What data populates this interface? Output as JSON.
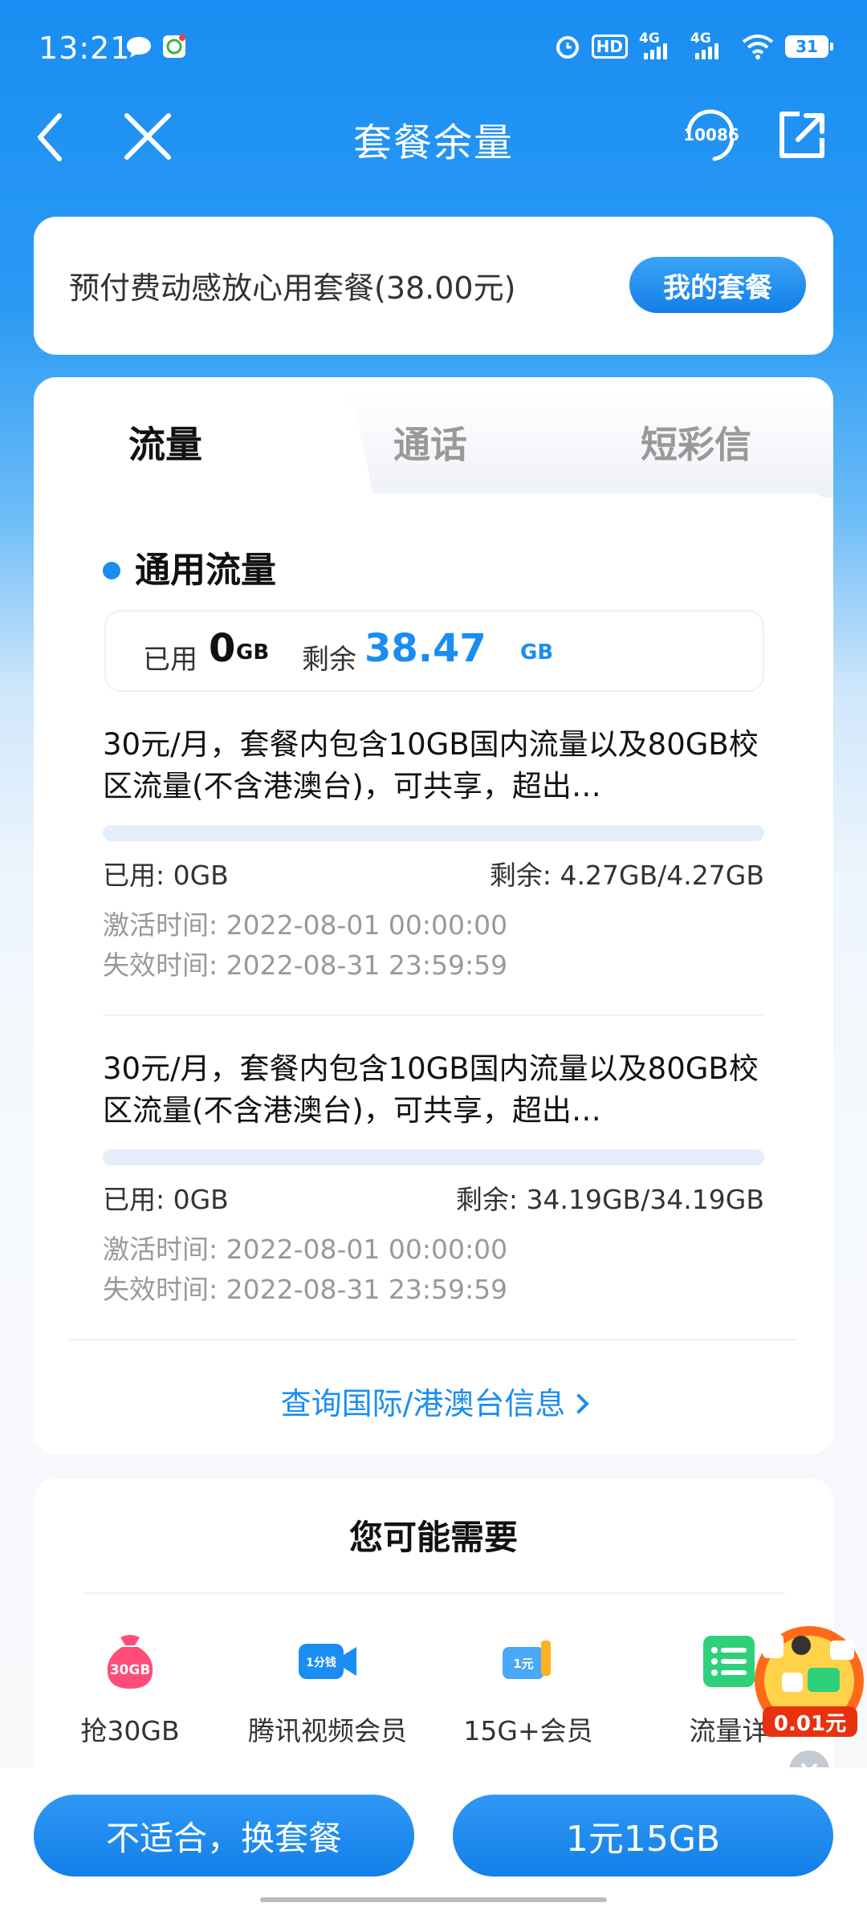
{
  "status_bar": {
    "time": "13:21",
    "hd_label": "HD",
    "network_1": "4G",
    "network_2": "4G",
    "battery": "31"
  },
  "nav": {
    "title": "套餐余量",
    "service_number": "10086"
  },
  "plan": {
    "name": "预付费动感放心用套餐(38.00元)",
    "my_plan_button": "我的套餐"
  },
  "tabs": [
    {
      "label": "流量",
      "active": true
    },
    {
      "label": "通话",
      "active": false
    },
    {
      "label": "短彩信",
      "active": false
    }
  ],
  "flow": {
    "section_title": "通用流量",
    "summary": {
      "used_label": "已用",
      "used_value": "0",
      "used_unit": "GB",
      "remaining_label": "剩余",
      "remaining_value": "38.47",
      "remaining_unit": "GB"
    },
    "packages": [
      {
        "description": "30元/月，套餐内包含10GB国内流量以及80GB校区流量(不含港澳台)，可共享，超出…",
        "used": "已用: 0GB",
        "remaining": "剩余: 4.27GB/4.27GB",
        "used_fraction": 0,
        "activate_time": "激活时间: 2022-08-01 00:00:00",
        "expire_time": "失效时间: 2022-08-31 23:59:59"
      },
      {
        "description": "30元/月，套餐内包含10GB国内流量以及80GB校区流量(不含港澳台)，可共享，超出…",
        "used": "已用: 0GB",
        "remaining": "剩余: 34.19GB/34.19GB",
        "used_fraction": 0,
        "activate_time": "激活时间: 2022-08-01 00:00:00",
        "expire_time": "失效时间: 2022-08-31 23:59:59"
      }
    ],
    "intl_link": "查询国际/港澳台信息"
  },
  "recommend": {
    "title": "您可能需要",
    "items": [
      {
        "label": "抢30GB",
        "badge": "30GB",
        "icon": "bag-icon"
      },
      {
        "label": "腾讯视频会员",
        "badge": "1分钱",
        "icon": "video-camera-icon"
      },
      {
        "label": "15G+会员",
        "badge": "1元",
        "icon": "ticket-icon"
      },
      {
        "label": "流量详",
        "icon": "list-icon"
      }
    ]
  },
  "promo": {
    "price": "0.01元"
  },
  "bottom": {
    "change_button": "不适合，换套餐",
    "buy_button": "1元15GB"
  },
  "colors": {
    "primary": "#1a8df2",
    "promo_red": "#e8320f"
  }
}
